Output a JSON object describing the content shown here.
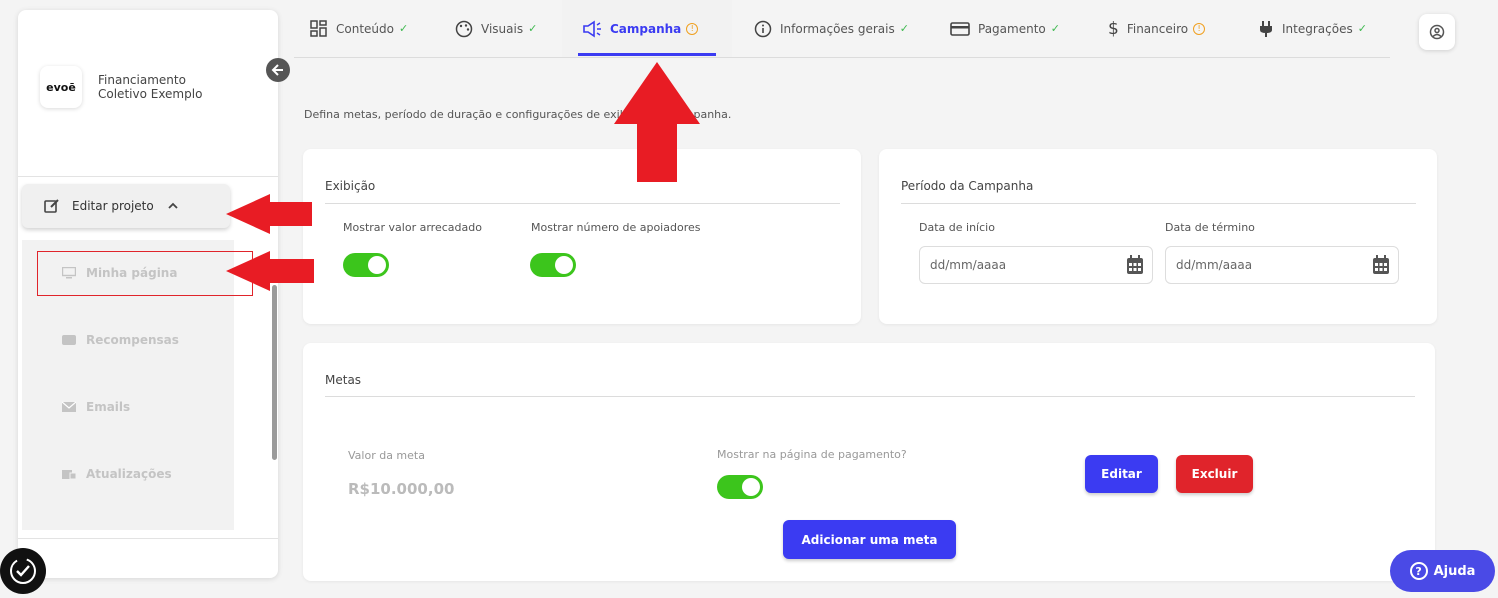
{
  "sidebar": {
    "logo_text": "evoē",
    "project_name": "Financiamento Coletivo Exemplo",
    "edit_project_label": "Editar projeto",
    "items": [
      {
        "label": "Minha página",
        "icon": "monitor-icon"
      },
      {
        "label": "Recompensas",
        "icon": "ticket-icon"
      },
      {
        "label": "Emails",
        "icon": "envelope-icon"
      },
      {
        "label": "Atualizações",
        "icon": "updates-icon"
      }
    ]
  },
  "tabs": [
    {
      "label": "Conteúdo",
      "icon": "grid-icon",
      "status": "ok"
    },
    {
      "label": "Visuais",
      "icon": "palette-icon",
      "status": "ok"
    },
    {
      "label": "Campanha",
      "icon": "megaphone-icon",
      "status": "warning",
      "active": true
    },
    {
      "label": "Informações gerais",
      "icon": "info-icon",
      "status": "ok"
    },
    {
      "label": "Pagamento",
      "icon": "credit-card-icon",
      "status": "ok"
    },
    {
      "label": "Financeiro",
      "icon": "dollar-icon",
      "status": "warning"
    },
    {
      "label": "Integrações",
      "icon": "plug-icon",
      "status": "ok"
    }
  ],
  "description": "Defina metas, período de duração e configurações de exibição da campanha.",
  "display_card": {
    "title": "Exibição",
    "show_raised_label": "Mostrar valor arrecadado",
    "show_raised": true,
    "show_backers_label": "Mostrar número de apoiadores",
    "show_backers": true
  },
  "period_card": {
    "title": "Período da Campanha",
    "start_label": "Data de início",
    "start_placeholder": "dd/mm/aaaa",
    "end_label": "Data de término",
    "end_placeholder": "dd/mm/aaaa"
  },
  "goals_card": {
    "title": "Metas",
    "goal_value_label": "Valor da meta",
    "goal_value": "R$10.000,00",
    "show_on_payment_label": "Mostrar na página de pagamento?",
    "show_on_payment": true,
    "edit_label": "Editar",
    "delete_label": "Excluir",
    "add_goal_label": "Adicionar uma meta"
  },
  "help_label": "Ajuda",
  "colors": {
    "accent": "#3b3bf2",
    "danger": "#e0242b",
    "toggle_on": "#3cc51c",
    "ok": "#3fb950",
    "warning": "#f0a020",
    "annotation_arrow": "#e81c24"
  }
}
